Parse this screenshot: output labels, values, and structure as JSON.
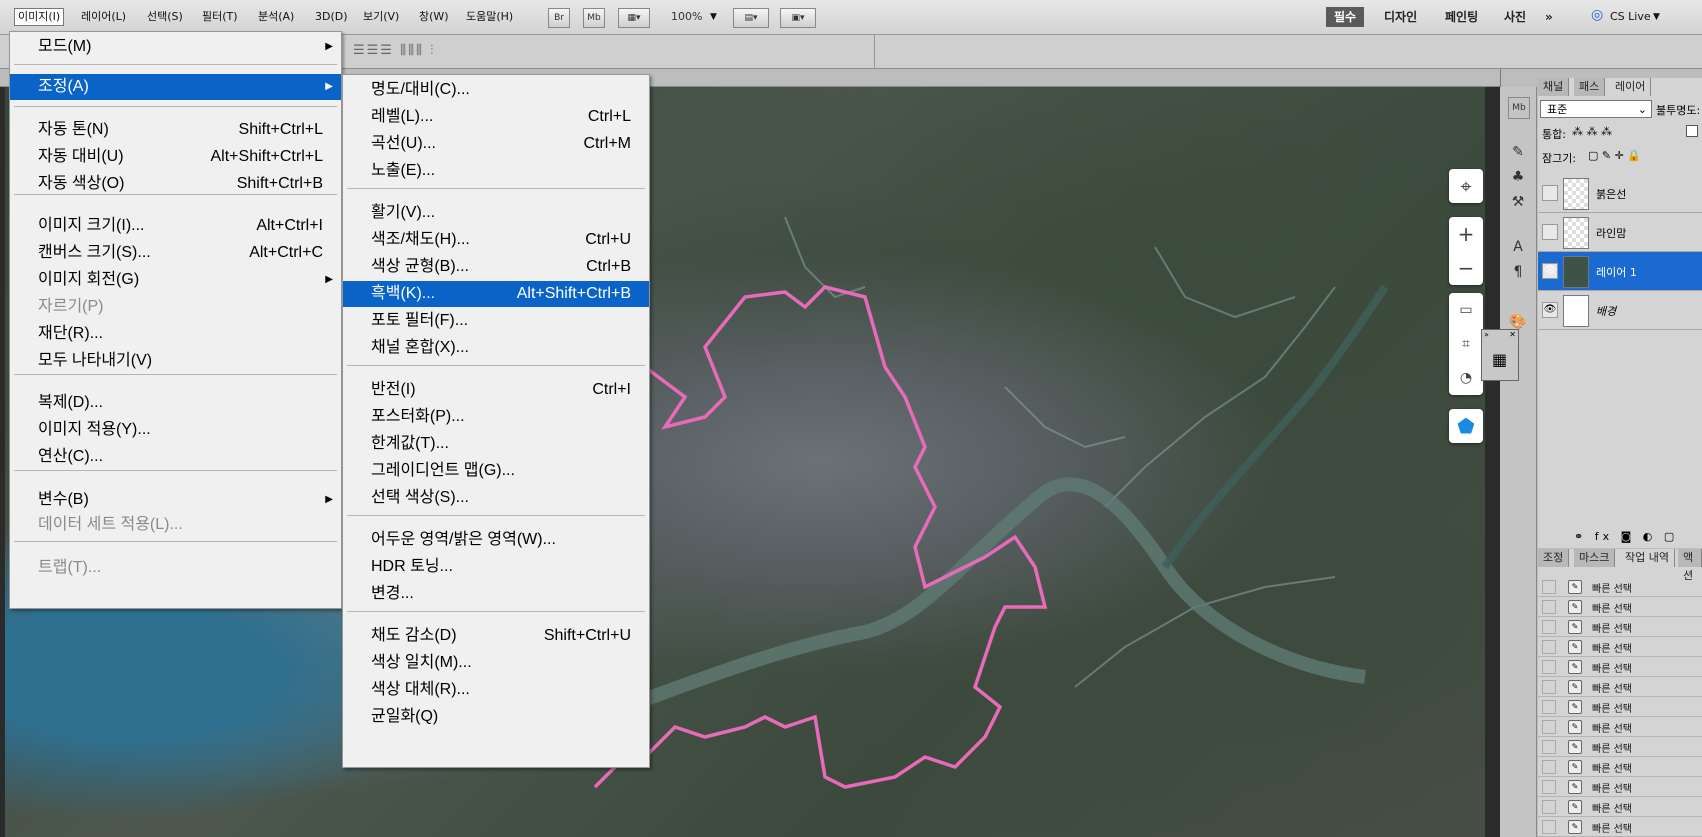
{
  "menubar": {
    "items": [
      "이미지(I)",
      "레이어(L)",
      "선택(S)",
      "필터(T)",
      "분석(A)",
      "3D(D)",
      "보기(V)",
      "창(W)",
      "도움말(H)"
    ],
    "zoom": "100%",
    "workspaces": [
      "필수",
      "디자인",
      "페인팅",
      "사진"
    ],
    "cs_live": "CS Live"
  },
  "image_menu": [
    {
      "label": "모드(M)",
      "shortcut": "",
      "submenu": true
    },
    {
      "label": "조정(A)",
      "shortcut": "",
      "submenu": true
    },
    {
      "label": "자동 톤(N)",
      "shortcut": "Shift+Ctrl+L"
    },
    {
      "label": "자동 대비(U)",
      "shortcut": "Alt+Shift+Ctrl+L"
    },
    {
      "label": "자동 색상(O)",
      "shortcut": "Shift+Ctrl+B"
    },
    {
      "label": "이미지 크기(I)...",
      "shortcut": "Alt+Ctrl+I"
    },
    {
      "label": "캔버스 크기(S)...",
      "shortcut": "Alt+Ctrl+C"
    },
    {
      "label": "이미지 회전(G)",
      "shortcut": "",
      "submenu": true
    },
    {
      "label": "자르기(P)",
      "shortcut": "",
      "disabled": true
    },
    {
      "label": "재단(R)...",
      "shortcut": ""
    },
    {
      "label": "모두 나타내기(V)",
      "shortcut": ""
    },
    {
      "label": "복제(D)...",
      "shortcut": ""
    },
    {
      "label": "이미지 적용(Y)...",
      "shortcut": ""
    },
    {
      "label": "연산(C)...",
      "shortcut": ""
    },
    {
      "label": "변수(B)",
      "shortcut": "",
      "submenu": true
    },
    {
      "label": "데이터 세트 적용(L)...",
      "shortcut": "",
      "disabled": true
    },
    {
      "label": "트랩(T)...",
      "shortcut": "",
      "disabled": true
    }
  ],
  "adjust_menu": [
    {
      "label": "명도/대비(C)...",
      "shortcut": ""
    },
    {
      "label": "레벨(L)...",
      "shortcut": "Ctrl+L"
    },
    {
      "label": "곡선(U)...",
      "shortcut": "Ctrl+M"
    },
    {
      "label": "노출(E)...",
      "shortcut": ""
    },
    {
      "label": "활기(V)...",
      "shortcut": ""
    },
    {
      "label": "색조/채도(H)...",
      "shortcut": "Ctrl+U"
    },
    {
      "label": "색상 균형(B)...",
      "shortcut": "Ctrl+B"
    },
    {
      "label": "흑백(K)...",
      "shortcut": "Alt+Shift+Ctrl+B"
    },
    {
      "label": "포토 필터(F)...",
      "shortcut": ""
    },
    {
      "label": "채널 혼합(X)...",
      "shortcut": ""
    },
    {
      "label": "반전(I)",
      "shortcut": "Ctrl+I"
    },
    {
      "label": "포스터화(P)...",
      "shortcut": ""
    },
    {
      "label": "한계값(T)...",
      "shortcut": ""
    },
    {
      "label": "그레이디언트 맵(G)...",
      "shortcut": ""
    },
    {
      "label": "선택 색상(S)...",
      "shortcut": ""
    },
    {
      "label": "어두운 영역/밝은 영역(W)...",
      "shortcut": ""
    },
    {
      "label": "HDR 토닝...",
      "shortcut": ""
    },
    {
      "label": "변경...",
      "shortcut": ""
    },
    {
      "label": "채도 감소(D)",
      "shortcut": "Shift+Ctrl+U"
    },
    {
      "label": "색상 일치(M)...",
      "shortcut": ""
    },
    {
      "label": "색상 대체(R)...",
      "shortcut": ""
    },
    {
      "label": "균일화(Q)",
      "shortcut": ""
    }
  ],
  "layers_panel": {
    "tabs": [
      "채널",
      "패스",
      "레이어"
    ],
    "blend_mode": "표준",
    "opacity_label": "불투명도:",
    "lock_label": "통합:",
    "fill_label": "잠그기:",
    "layers": [
      {
        "name": "붉은선",
        "visible": false
      },
      {
        "name": "라인맘",
        "visible": false
      },
      {
        "name": "레이어 1",
        "visible": true,
        "selected": true
      },
      {
        "name": "배경",
        "visible": true
      }
    ]
  },
  "history_panel": {
    "tabs": [
      "조정",
      "마스크",
      "작업 내역",
      "액션"
    ],
    "items": [
      "빠른 선택",
      "빠른 선택",
      "빠른 선택",
      "빠른 선택",
      "빠른 선택",
      "빠른 선택",
      "빠른 선택",
      "빠른 선택",
      "빠른 선택",
      "빠른 선택",
      "빠른 선택",
      "빠른 선택",
      "빠른 선택"
    ]
  },
  "colors": {
    "highlight": "#0a64c8",
    "boundary": "#e86ab8"
  }
}
